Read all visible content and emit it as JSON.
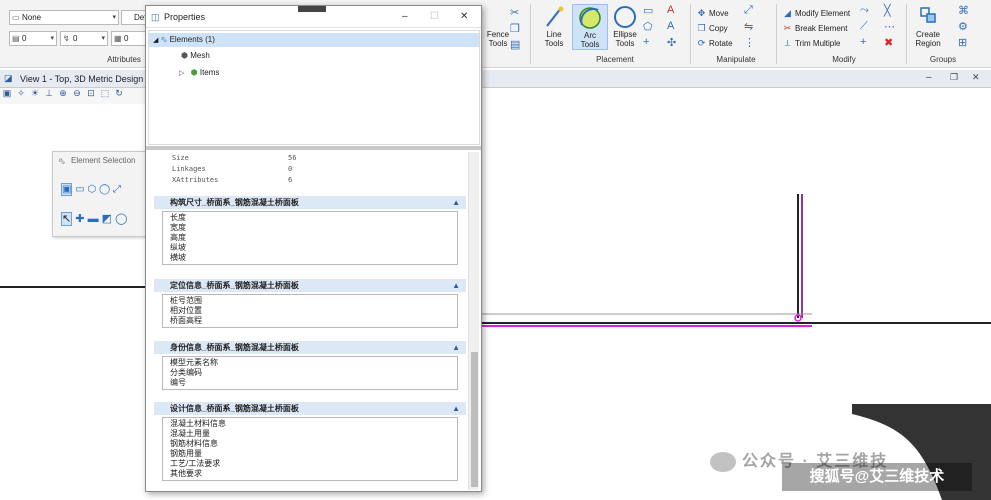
{
  "ribbon": {
    "level_value": "None",
    "default_value": "Defau",
    "weight_value": "0",
    "style_value": "0",
    "color_value": "0",
    "attributes_label": "Attributes",
    "fence_label": "Fence",
    "tools_label": "Tools",
    "line_label": "Line",
    "arc_label": "Arc",
    "ellipse_label": "Ellipse",
    "placement_label": "Placement",
    "move_label": "Move",
    "copy_label": "Copy",
    "rotate_label": "Rotate",
    "manipulate_label": "Manipulate",
    "modify_element_label": "Modify Element",
    "break_element_label": "Break Element",
    "trim_multiple_label": "Trim Multiple",
    "modify_label": "Modify",
    "create_label": "Create",
    "region_label": "Region",
    "groups_label": "Groups"
  },
  "view": {
    "title": "View 1 - Top, 3D Metric Design"
  },
  "element_selection": {
    "title": "Element Selection"
  },
  "properties": {
    "title": "Properties",
    "tree": [
      {
        "label": "Elements (1)"
      },
      {
        "label": "Mesh"
      },
      {
        "label": "Items"
      }
    ],
    "general": [
      {
        "key": "Size",
        "value": "56"
      },
      {
        "key": "Linkages",
        "value": "0"
      },
      {
        "key": "XAttributes",
        "value": "6"
      }
    ],
    "sections": [
      {
        "title": "构筑尺寸_桥面系_钢筋混凝土桥面板",
        "items": [
          "长度",
          "宽度",
          "高度",
          "纵坡",
          "横坡"
        ]
      },
      {
        "title": "定位信息_桥面系_钢筋混凝土桥面板",
        "items": [
          "桩号范围",
          "相对位置",
          "桥面高程"
        ]
      },
      {
        "title": "身份信息_桥面系_钢筋混凝土桥面板",
        "items": [
          "模型元素名称",
          "分类编码",
          "编号"
        ]
      },
      {
        "title": "设计信息_桥面系_钢筋混凝土桥面板",
        "items": [
          "混凝土材料信息",
          "混凝土用量",
          "钢筋材料信息",
          "钢筋用量",
          "工艺/工法要求",
          "其他要求"
        ]
      }
    ]
  },
  "watermark": {
    "line1": "公众号 · 艾三维技",
    "line2": "搜狐号@艾三维技术"
  },
  "colors": {
    "accent": "#2a6ebb",
    "magenta": "#e020e0",
    "section_header": "#dde8f6"
  }
}
